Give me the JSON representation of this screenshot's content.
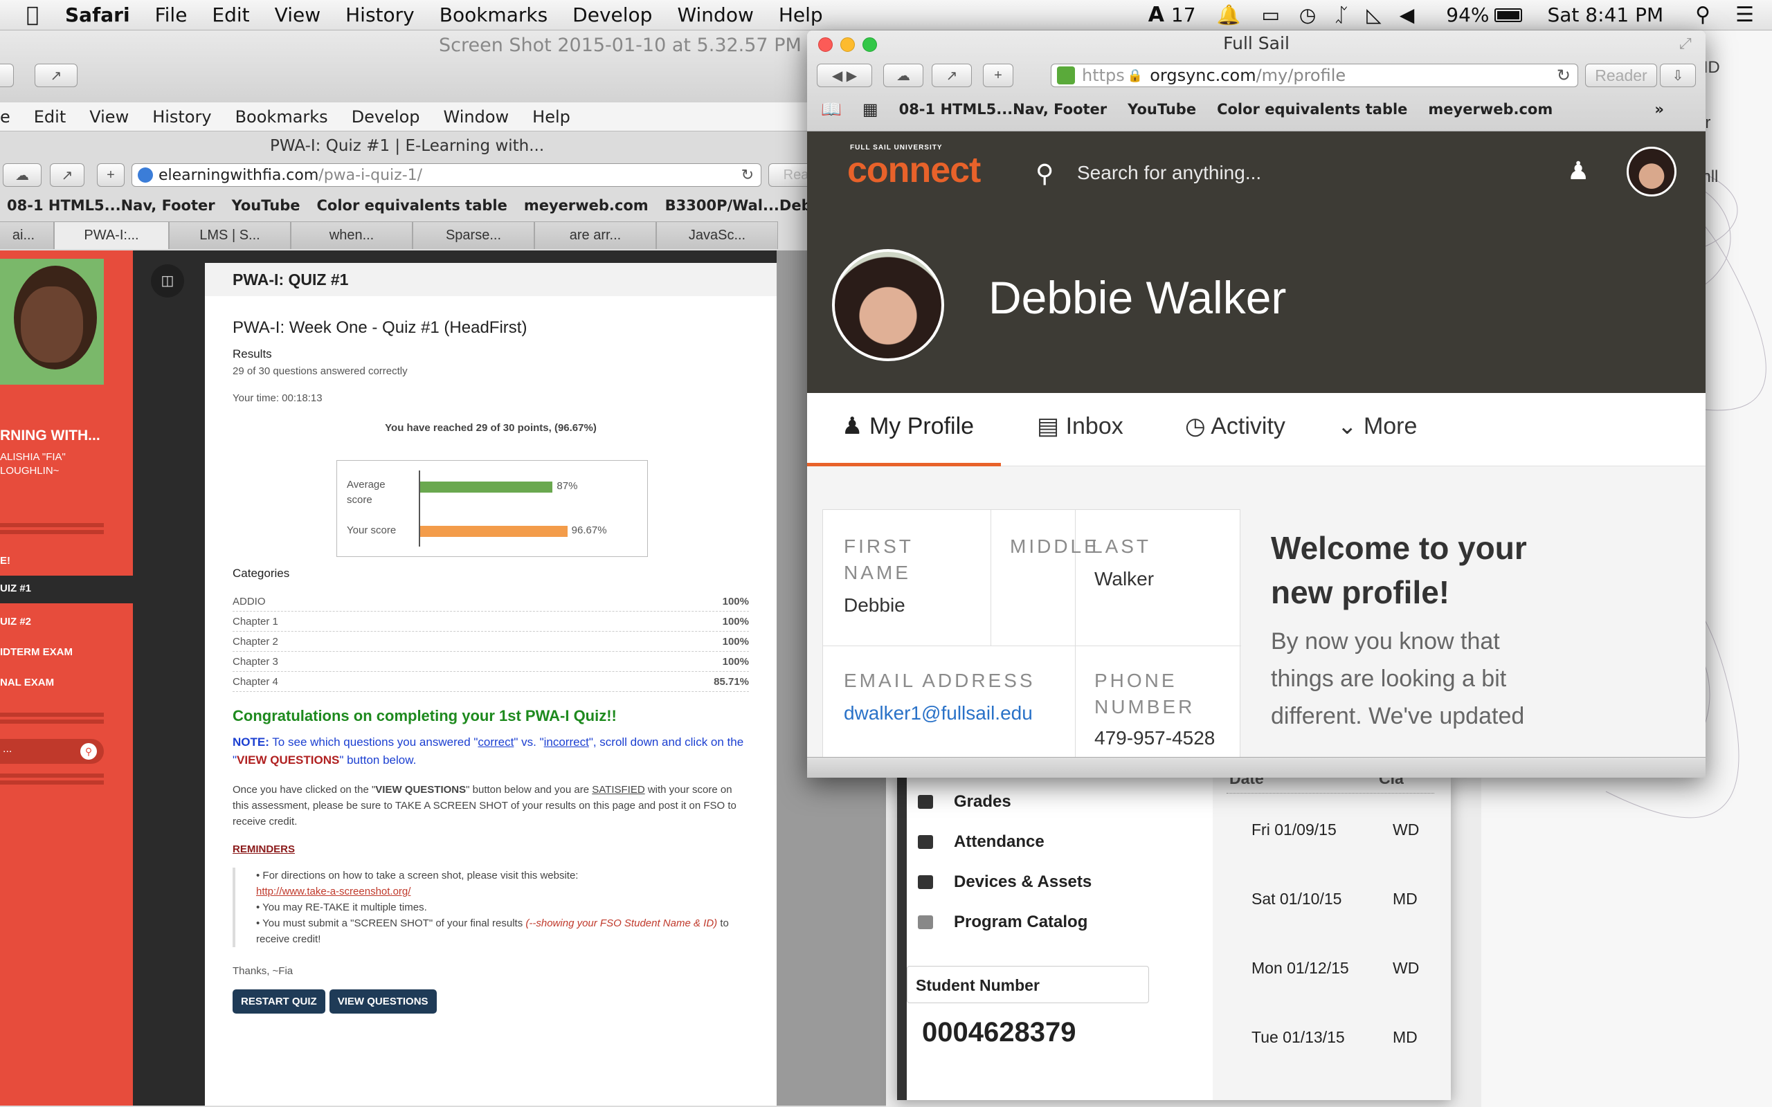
{
  "menubar": {
    "app": "Safari",
    "items": [
      "File",
      "Edit",
      "View",
      "History",
      "Bookmarks",
      "Develop",
      "Window",
      "Help"
    ],
    "adobe_count": "17",
    "battery": "94%",
    "clock": "Sat 8:41 PM"
  },
  "back": {
    "title_top": "Screen Shot 2015-01-10 at 5.32.57 PM",
    "menu": [
      "e",
      "Edit",
      "View",
      "History",
      "Bookmarks",
      "Develop",
      "Window",
      "Help"
    ],
    "title": "PWA-I: Quiz #1 | E-Learning with...",
    "url_host": "elearningwithfia.com",
    "url_path": "/pwa-i-quiz-1/",
    "reader": "Rea",
    "bookmarks": [
      "08-1 HTML5...Nav, Footer",
      "YouTube",
      "Color equivalents table",
      "meyerweb.com",
      "B3300P/Wal...Debbie_WPF"
    ],
    "tabs": [
      "ai...",
      "PWA-I:...",
      "LMS | S...",
      "when...",
      "Sparse...",
      "are arr...",
      "JavaSc..."
    ],
    "sidebar": {
      "name": "RNING WITH...",
      "author1": "ALISHIA \"FIA\"",
      "author2": "LOUGHLIN~",
      "items": [
        "E!",
        "UIZ #1",
        "UIZ #2",
        "IDTERM EXAM",
        "NAL EXAM"
      ],
      "search": "..."
    },
    "quiz": {
      "header": "PWA-I: QUIZ #1",
      "title": "PWA-I: Week One - Quiz #1 (HeadFirst)",
      "results": "Results",
      "answered": "29 of 30 questions answered correctly",
      "time": "Your time: 00:18:13",
      "points": "You have reached 29 of 30 points, (96.67%)",
      "avg_label_1": "Average",
      "avg_label_2": "score",
      "avg_value": "87%",
      "avg_fraction": 0.87,
      "your_label": "Your score",
      "your_value": "96.67%",
      "your_fraction": 0.9667,
      "categories_title": "Categories",
      "categories": [
        {
          "name": "ADDIO",
          "value": "100%"
        },
        {
          "name": "Chapter 1",
          "value": "100%"
        },
        {
          "name": "Chapter 2",
          "value": "100%"
        },
        {
          "name": "Chapter 3",
          "value": "100%"
        },
        {
          "name": "Chapter 4",
          "value": "85.71%"
        }
      ],
      "congrats": "Congratulations on completing your 1st PWA-I Quiz!!",
      "note_label": "NOTE:",
      "note_a": " To see which questions you answered \"",
      "note_correct": "correct",
      "note_b": "\" vs. \"",
      "note_incorrect": "incorrect",
      "note_c": "\", scroll down and click on the \"",
      "note_vq": "VIEW QUESTIONS",
      "note_d": "\" button below.",
      "para_a": "Once you have clicked on the \"",
      "para_vq": "VIEW QUESTIONS",
      "para_b": "\" button below and you are ",
      "para_sat": "SATISFIED",
      "para_c": " with your score on this assessment, please be sure to TAKE A SCREEN SHOT of your results on this page and post it on FSO to receive credit.",
      "reminders": "REMINDERS",
      "rem1": "For directions on how to take a screen shot, please visit this website:",
      "rem1_link": "http://www.take-a-screenshot.org/",
      "rem2": "You may RE-TAKE it multiple times.",
      "rem3a": "You must submit a \"SCREEN SHOT\" of your final results ",
      "rem3b": "(--showing your FSO Student Name & ID)",
      "rem3c": " to receive credit!",
      "thanks": "Thanks, ~Fia",
      "restart": "RESTART QUIZ",
      "view": "VIEW QUESTIONS"
    }
  },
  "front": {
    "title": "Full Sail",
    "url_scheme": "https",
    "url_host": "orgsync.com",
    "url_path": "/my/profile",
    "reader": "Reader",
    "bookmarks": [
      "08-1 HTML5...Nav, Footer",
      "YouTube",
      "Color equivalents table",
      "meyerweb.com"
    ],
    "logo_top": "FULL SAIL UNIVERSITY",
    "logo": "connect",
    "search_placeholder": "Search for anything...",
    "name": "Debbie Walker",
    "tabs": [
      "My Profile",
      "Inbox",
      "Activity",
      "More"
    ],
    "first_label_1": "FIRST",
    "first_label_2": "NAME",
    "first": "Debbie",
    "middle_label": "MIDDLE",
    "last_label": "LAST",
    "last": "Walker",
    "email_label": "EMAIL ADDRESS",
    "email": "dwalker1@fullsail.edu",
    "phone_label_1": "PHONE",
    "phone_label_2": "NUMBER",
    "phone": "479-957-4528",
    "welcome_1": "Welcome to your",
    "welcome_2": "new profile!",
    "welcome_body": [
      "By now you know that",
      "things are looking a bit",
      "different. We've updated"
    ]
  },
  "panel": {
    "items": [
      "Grades",
      "Attendance",
      "Devices & Assets",
      "Program Catalog"
    ],
    "student_number_label": "Student Number",
    "student_number": "0004628379",
    "dates": [
      "Fri 01/09/15",
      "Sat 01/10/15",
      "Mon 01/12/15",
      "Tue 01/13/15"
    ],
    "codes": [
      "WD",
      "MD",
      "WD",
      "MD"
    ],
    "col1": "Date",
    "col2": "Cla"
  },
  "right_edge": [
    "HD",
    "er",
    "gnll"
  ]
}
